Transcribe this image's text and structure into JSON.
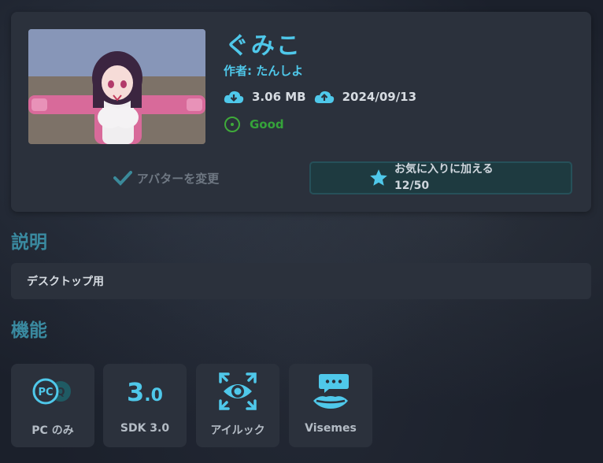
{
  "avatar": {
    "name": "ぐみこ",
    "author_label": "作者: たんしよ",
    "size": "3.06 MB",
    "date": "2024/09/13",
    "performance": "Good"
  },
  "actions": {
    "change_avatar": "アバターを変更",
    "favorite_label": "お気に入りに加える",
    "favorite_count": "12/50"
  },
  "description": {
    "heading": "説明",
    "text": "デスクトップ用"
  },
  "features": {
    "heading": "機能",
    "items": [
      {
        "label": "PC のみ",
        "icon": "pc-quest-icon"
      },
      {
        "label": "SDK 3.0",
        "icon": "sdk-version-icon",
        "glyph": "3.0"
      },
      {
        "label": "アイルック",
        "icon": "eye-look-icon"
      },
      {
        "label": "Visemes",
        "icon": "visemes-icon"
      }
    ]
  },
  "colors": {
    "accent": "#4fc8ea",
    "good": "#35a33a",
    "card": "#2b313c",
    "heading": "#3a8aa0"
  }
}
